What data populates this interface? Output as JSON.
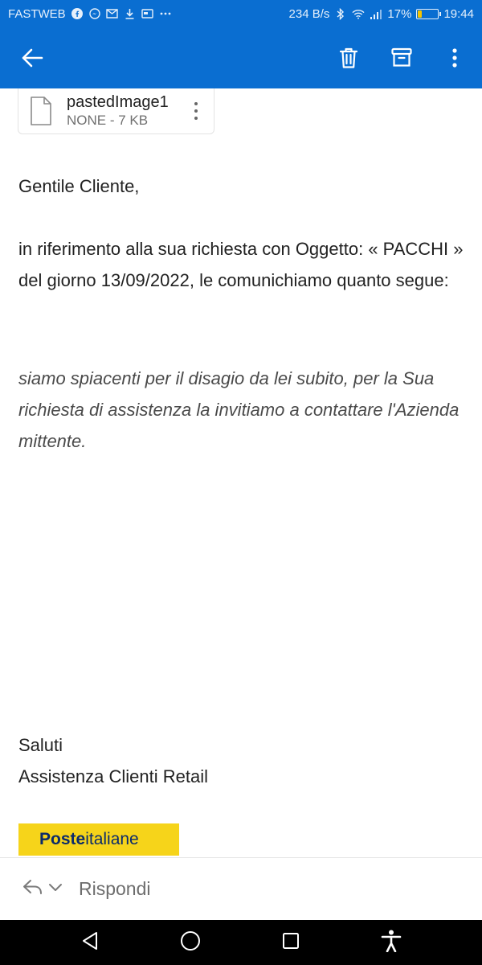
{
  "status_bar": {
    "carrier": "FASTWEB",
    "network_speed": "234 B/s",
    "battery_percent": "17%",
    "battery_level": 0.17,
    "time": "19:44",
    "left_icons": [
      "facebook-icon",
      "messenger-icon",
      "gmail-icon",
      "download-icon",
      "card-icon",
      "more-dots-icon"
    ],
    "right_icons": [
      "bluetooth-icon",
      "wifi-icon",
      "signal-icon",
      "battery-icon"
    ]
  },
  "app_bar": {
    "icons": [
      "back-arrow-icon",
      "trash-icon",
      "archive-icon",
      "more-vert-icon"
    ],
    "color": "#0a6ed1"
  },
  "attachment": {
    "name": "pastedImage1",
    "meta": "NONE - 7 KB"
  },
  "email": {
    "greeting": "Gentile Cliente,",
    "para1": "in riferimento alla sua richiesta con Oggetto: « PACCHI » del giorno 13/09/2022, le comunichiamo quanto segue:",
    "para2": "siamo spiacenti per il disagio da lei subito, per la Sua richiesta di assistenza la invitiamo a contattare l'Azienda mittente.",
    "signoff_line1": "Saluti",
    "signoff_line2": "Assistenza Clienti Retail",
    "logo_bold": "Poste",
    "logo_regular": "italiane"
  },
  "reply_bar": {
    "label": "Rispondi"
  },
  "nav_bar": {
    "icons": [
      "back-triangle-icon",
      "home-circle-icon",
      "recents-square-icon",
      "accessibility-icon"
    ]
  }
}
